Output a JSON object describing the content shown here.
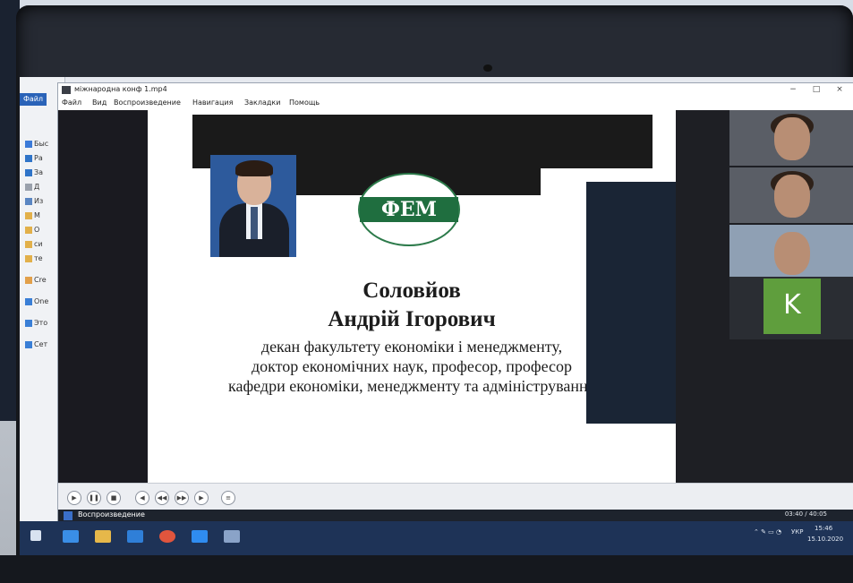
{
  "player": {
    "title": "міжнародна конф 1.mp4",
    "menu": [
      "Файл",
      "Вид",
      "Воспроизведение",
      "Навигация",
      "Закладки",
      "Помощь"
    ],
    "window_buttons": [
      "−",
      "□",
      "×"
    ],
    "status_label": "Воспроизведение",
    "time": "03:40 / 40:05"
  },
  "explorer": {
    "tab": "Файл",
    "items": [
      "Быс",
      "Ра",
      "За",
      "Д",
      "Из",
      "М",
      "О",
      "си",
      "те",
      "Cre",
      "One",
      "Это",
      "Сет"
    ]
  },
  "slide": {
    "logo_text": "ФЕМ",
    "name_line1": "Соловйов",
    "name_line2": "Андрій Ігорович",
    "description": [
      "декан факультету економіки і менеджменту,",
      "доктор економічних наук, професор, професор",
      "кафедри економіки, менеджменту та адміністрування"
    ]
  },
  "gallery": {
    "participant_initial": "K"
  },
  "taskbar": {
    "language": "УКР",
    "clock_time": "15:46",
    "clock_date": "15.10.2020"
  },
  "colors": {
    "taskbar": "#1e3357",
    "logo_green": "#1f6e3f",
    "avatar_green": "#5f9e3d"
  }
}
